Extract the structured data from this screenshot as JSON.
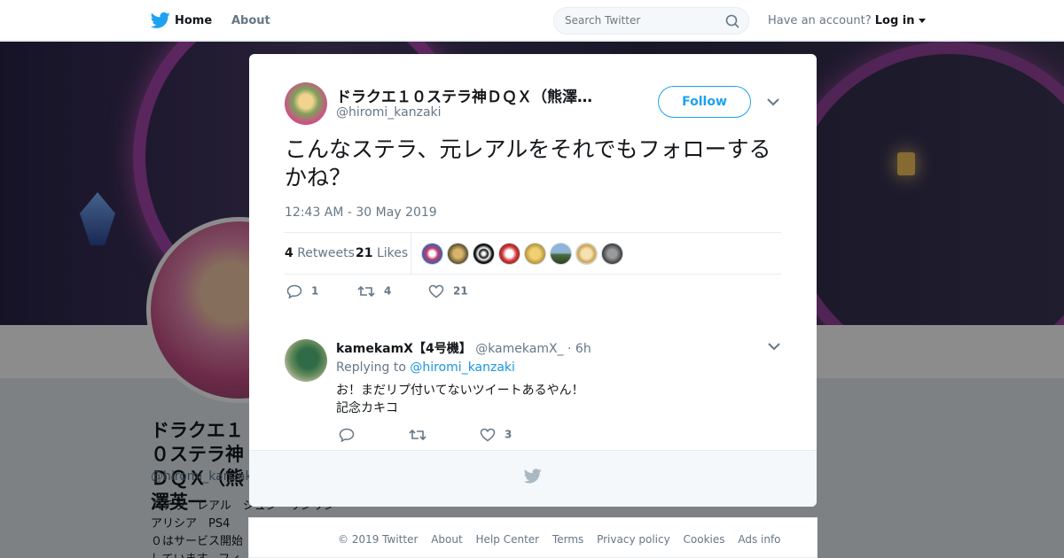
{
  "nav": {
    "home": "Home",
    "about": "About",
    "search_placeholder": "Search Twitter",
    "account_prompt": "Have an account?",
    "login": "Log in"
  },
  "background_profile": {
    "name": "ドラクエ１０ステラ神ＤＱＸ（熊澤英一",
    "handle": "@hiromi_kanzaki",
    "bio_lines": [
      "ステラ　レアル　シュン・リンリン",
      "アリシア　PS4",
      "０はサービス開始",
      "しています。フィ"
    ]
  },
  "tweet": {
    "author_name": "ドラクエ１０ステラ神ＤＱＸ（熊澤…",
    "author_handle": "@hiromi_kanzaki",
    "follow_label": "Follow",
    "text": "こんなステラ、元レアルをそれでもフォローするかね？",
    "timestamp": "12:43 AM - 30 May 2019",
    "retweets_count": "4",
    "retweets_label": "Retweets",
    "likes_count": "21",
    "likes_label": "Likes",
    "likers_count_shown": 8,
    "actions": {
      "replies": "1",
      "retweets": "4",
      "likes": "21"
    }
  },
  "reply": {
    "name": "kamekamX【4号機】",
    "handle": "@kamekamX_",
    "time": "· 6h",
    "replying_label": "Replying to",
    "replying_handle": "@hiromi_kanzaki",
    "text_line1": "お！まだリプ付いてないツイートあるやん！",
    "text_line2": "記念カキコ",
    "likes": "3"
  },
  "footer": {
    "copyright": "© 2019 Twitter",
    "links": [
      "About",
      "Help Center",
      "Terms",
      "Privacy policy",
      "Cookies",
      "Ads info"
    ]
  },
  "colors": {
    "brand": "#1da1f2",
    "link": "#1b95e0",
    "muted": "#657786",
    "text": "#14171a"
  },
  "icons": [
    "twitter-bird-icon",
    "search-icon",
    "close-icon",
    "chevron-down-icon",
    "reply-icon",
    "retweet-icon",
    "like-icon"
  ]
}
